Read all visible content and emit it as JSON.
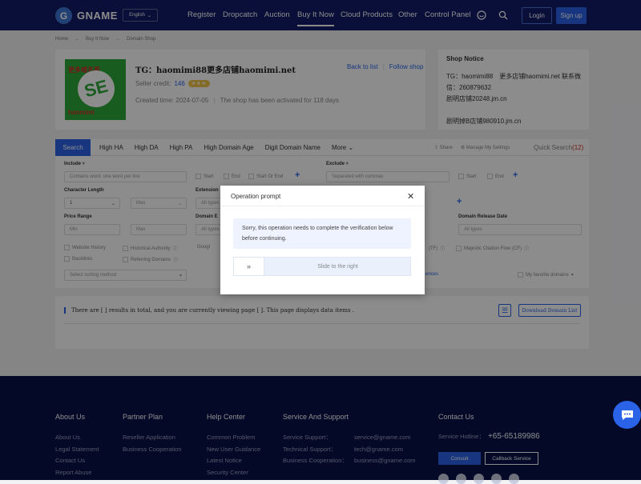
{
  "header": {
    "brand": "GNAME",
    "logo_letter": "G",
    "language": "English",
    "nav": [
      "Register",
      "Dropcatch",
      "Auction",
      "Buy It Now",
      "Cloud Products",
      "Other",
      "Control Panel"
    ],
    "active_nav": "Buy It Now",
    "login": "Login",
    "signup": "Sign up"
  },
  "breadcrumb": [
    "Home",
    "Buy It Now",
    "Domain Shop"
  ],
  "shop": {
    "title": "TG：haomimi88更多店铺haomimi.net",
    "image_text_top": "更多域名看",
    "image_text_bottom": "haomimi",
    "image_mark": "SE",
    "credit_label": "Seller credit:",
    "credit_value": "146",
    "stars": "★★★",
    "created": "Created time: 2024-07-05",
    "activated": "The shop has been activated for 118 days",
    "back_to_list": "Back to list",
    "follow": "Follow shop"
  },
  "notice": {
    "title": "Shop Notice",
    "body": "TG：haomimi88　更多店铺haomimi.net 联系微\n信：260879632\n剧明店铺20248.jm.cn\n\n剧明掉B店铺980910.jm.cn"
  },
  "search_bar": {
    "search": "Search",
    "tabs": [
      "High HA",
      "High DA",
      "High PA",
      "High Domain Age",
      "Digit Domain Name",
      "More"
    ],
    "share": "Share",
    "manage": "Manage My Settings",
    "quick": "Quick Search",
    "quick_count": "(12)"
  },
  "filters": {
    "include": "Include",
    "include_placeholder": "Contains word: one word per line",
    "start": "Start",
    "end": "End",
    "start_or_end": "Start Or End",
    "exclude": "Exclude",
    "exclude_placeholder": "Separated with commas",
    "char_length": "Character Length",
    "char_min": "1",
    "char_max": "Max",
    "extension": "Extension",
    "all_types": "All types",
    "price_range": "Price Range",
    "price_min": "Min",
    "price_max": "Max",
    "domain_e": "Domain E",
    "release_date": "Domain Release Date",
    "website_history": "Website History",
    "historical_authority": "Historical Authority",
    "backlinks": "Backlinks",
    "referring_domains": "Referring Domains",
    "google": "Googl",
    "tf": "(TF)",
    "majestic": "Majestic Citation Flow (CF)",
    "sorting": "Select sorting method",
    "ences": "ences",
    "favorite": "My favorite domains"
  },
  "results": {
    "text": "There are [ ] results in total, and you are currently viewing page [ ]. This page displays data items .",
    "download": "Download Domain List"
  },
  "modal": {
    "title": "Operation prompt",
    "message": "Sorry, this operation needs to complete the verification below before continuing.",
    "slider_handle": "»",
    "slider_label": "Slide to the right"
  },
  "footer": {
    "about": {
      "title": "About Us",
      "items": [
        "About Us",
        "Legal Statement",
        "Contact Us",
        "Report Abuse"
      ]
    },
    "partner": {
      "title": "Partner Plan",
      "items": [
        "Reseller Application",
        "Business Cooperation"
      ]
    },
    "help": {
      "title": "Help Center",
      "items": [
        "Common Problem",
        "New User Guidance",
        "Latest Notice",
        "Security Center"
      ]
    },
    "service": {
      "title": "Service And Support",
      "rows": [
        {
          "k": "Service Support：",
          "v": "service@gname.com"
        },
        {
          "k": "Technical Support：",
          "v": "tech@gname.com"
        },
        {
          "k": "Business Cooperation：",
          "v": "business@gname.com"
        }
      ]
    },
    "contact": {
      "title": "Contact Us",
      "hotline_label": "Service Hotline：",
      "hotline": "+65-65189986",
      "consult": "Consult",
      "callback": "Callback Service"
    }
  },
  "colors": {
    "header_bg": "#111d66",
    "accent": "#2a63e8",
    "footer_bg": "#09124a"
  }
}
